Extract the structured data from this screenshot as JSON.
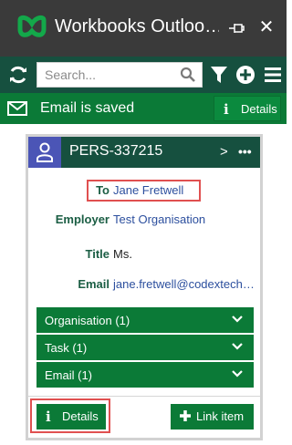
{
  "window": {
    "title": "Workbooks Outloo…",
    "pin_icon": "pin-icon",
    "close_glyph": "✕"
  },
  "toolbar": {
    "search_placeholder": "Search...",
    "icons": [
      "refresh-icon",
      "search-icon",
      "filter-icon",
      "plus-circle-icon",
      "menu-icon"
    ]
  },
  "status": {
    "message": "Email is saved",
    "details_label": "Details"
  },
  "card": {
    "record_id": "PERS-337215",
    "chevron": ">",
    "more": "•••",
    "fields": {
      "to_label": "To",
      "to_value": "Jane Fretwell",
      "employer_label": "Employer",
      "employer_value": "Test Organisation",
      "title_label": "Title",
      "title_value": "Ms.",
      "email_label": "Email",
      "email_value": "jane.fretwell@codextech…"
    },
    "sections": [
      {
        "label": "Organisation (1)"
      },
      {
        "label": "Task (1)"
      },
      {
        "label": "Email (1)"
      }
    ],
    "buttons": {
      "details": "Details",
      "link_item": "Link item"
    }
  },
  "colors": {
    "titlebar": "#3a3a3a",
    "toolbar": "#16503f",
    "accent_green": "#0b7a37",
    "user_icon_bg": "#4b55b6",
    "highlight_red": "#e05050",
    "link_blue": "#2c4f9e"
  }
}
